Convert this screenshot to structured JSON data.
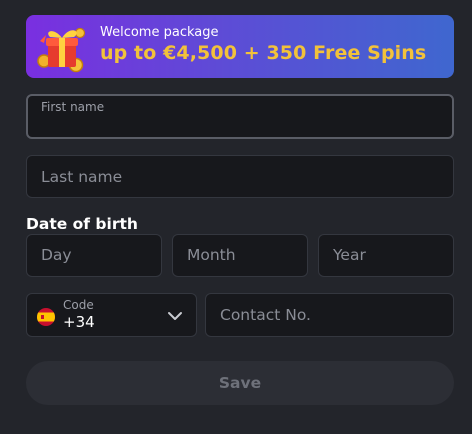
{
  "promo": {
    "subtitle": "Welcome package",
    "title": "up to €4,500 + 350 Free Spins"
  },
  "form": {
    "first_name_label": "First name",
    "first_name_value": "",
    "last_name_placeholder": "Last name",
    "dob_label": "Date of birth",
    "day_placeholder": "Day",
    "month_placeholder": "Month",
    "year_placeholder": "Year",
    "code_label": "Code",
    "code_value": "+34",
    "contact_placeholder": "Contact No.",
    "save_label": "Save"
  },
  "icons": {
    "promo": "gift-icon",
    "flag": "spain-flag-icon",
    "dropdown": "chevron-down-icon"
  },
  "colors": {
    "accent_gold": "#f2c23a",
    "promo_gradient_start": "#7a2fe0",
    "promo_gradient_end": "#3f67cf"
  }
}
